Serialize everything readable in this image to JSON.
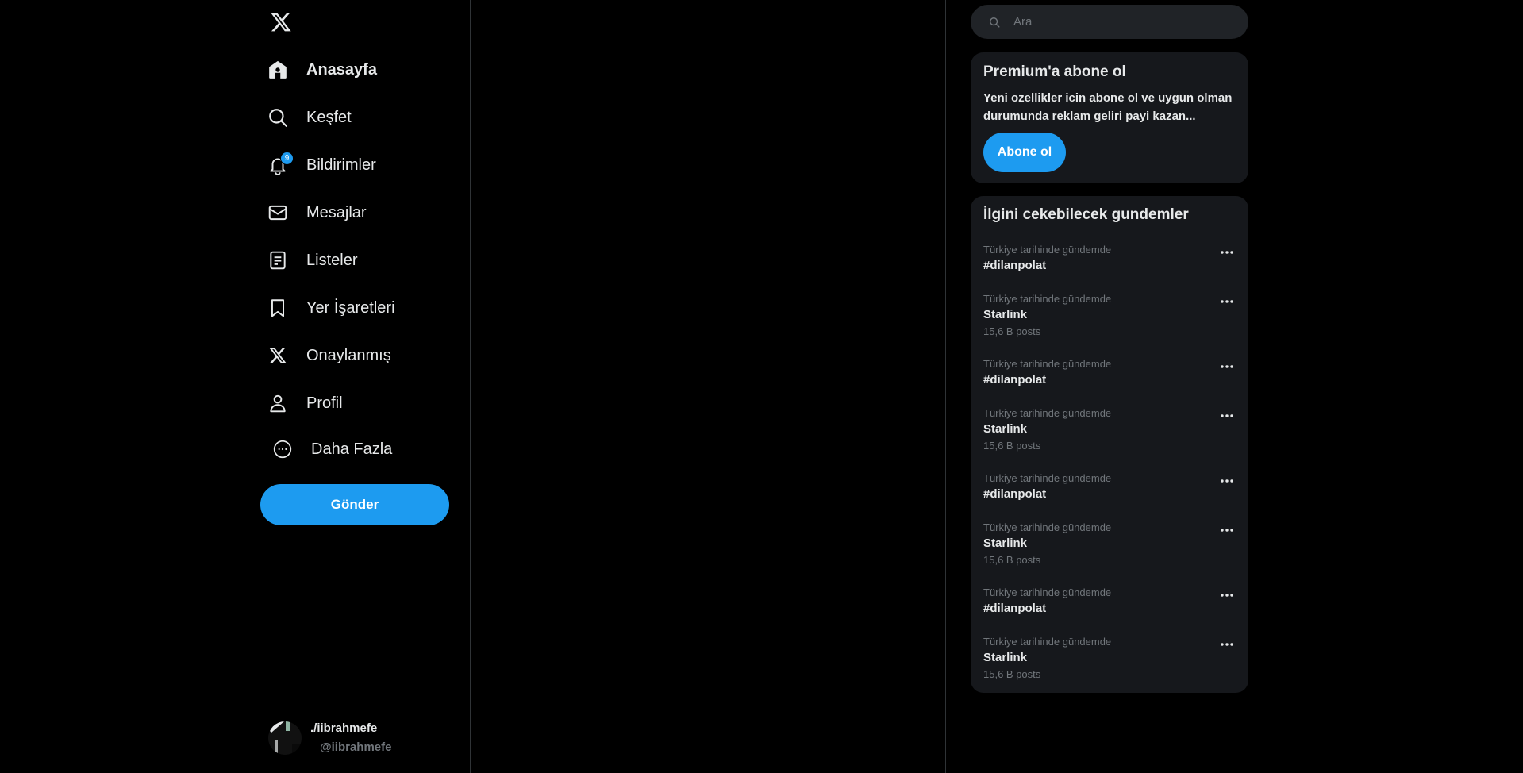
{
  "colors": {
    "background": "#000000",
    "accent": "#1d9bf0",
    "card": "#16181c",
    "search_bg": "#202327",
    "text_primary": "#e7e9ea",
    "text_secondary": "#71767b",
    "divider": "#2f3336"
  },
  "sidebar": {
    "logo_icon": "x-logo-icon",
    "items": [
      {
        "label": "Anasayfa",
        "icon": "home-icon",
        "active": true
      },
      {
        "label": "Keşfet",
        "icon": "search-icon",
        "active": false
      },
      {
        "label": "Bildirimler",
        "icon": "bell-icon",
        "active": false,
        "badge": "9"
      },
      {
        "label": "Mesajlar",
        "icon": "mail-icon",
        "active": false
      },
      {
        "label": "Listeler",
        "icon": "list-icon",
        "active": false
      },
      {
        "label": "Yer İşaretleri",
        "icon": "bookmark-icon",
        "active": false
      },
      {
        "label": "Onaylanmış",
        "icon": "x-logo-icon",
        "active": false
      },
      {
        "label": "Profil",
        "icon": "person-icon",
        "active": false
      },
      {
        "label": "Daha Fazla",
        "icon": "more-circle-icon",
        "active": false
      }
    ],
    "post_button_label": "Gönder",
    "account": {
      "display_name": "./iibrahmefe",
      "handle": "@iibrahmefe"
    }
  },
  "search": {
    "placeholder": "Ara",
    "value": ""
  },
  "premium": {
    "title": "Premium'a abone ol",
    "description": "Yeni ozellikler icin abone ol ve uygun olman durumunda reklam geliri payi kazan...",
    "button_label": "Abone ol"
  },
  "trends": {
    "title": "İlgini cekebilecek gundemler",
    "items": [
      {
        "context": "Türkiye tarihinde gündemde",
        "name": "#dilanpolat",
        "count": ""
      },
      {
        "context": "Türkiye tarihinde gündemde",
        "name": "Starlink",
        "count": "15,6 B posts"
      },
      {
        "context": "Türkiye tarihinde gündemde",
        "name": "#dilanpolat",
        "count": ""
      },
      {
        "context": "Türkiye tarihinde gündemde",
        "name": "Starlink",
        "count": "15,6 B posts"
      },
      {
        "context": "Türkiye tarihinde gündemde",
        "name": "#dilanpolat",
        "count": ""
      },
      {
        "context": "Türkiye tarihinde gündemde",
        "name": "Starlink",
        "count": "15,6 B posts"
      },
      {
        "context": "Türkiye tarihinde gündemde",
        "name": "#dilanpolat",
        "count": ""
      },
      {
        "context": "Türkiye tarihinde gündemde",
        "name": "Starlink",
        "count": "15,6 B posts"
      }
    ]
  }
}
